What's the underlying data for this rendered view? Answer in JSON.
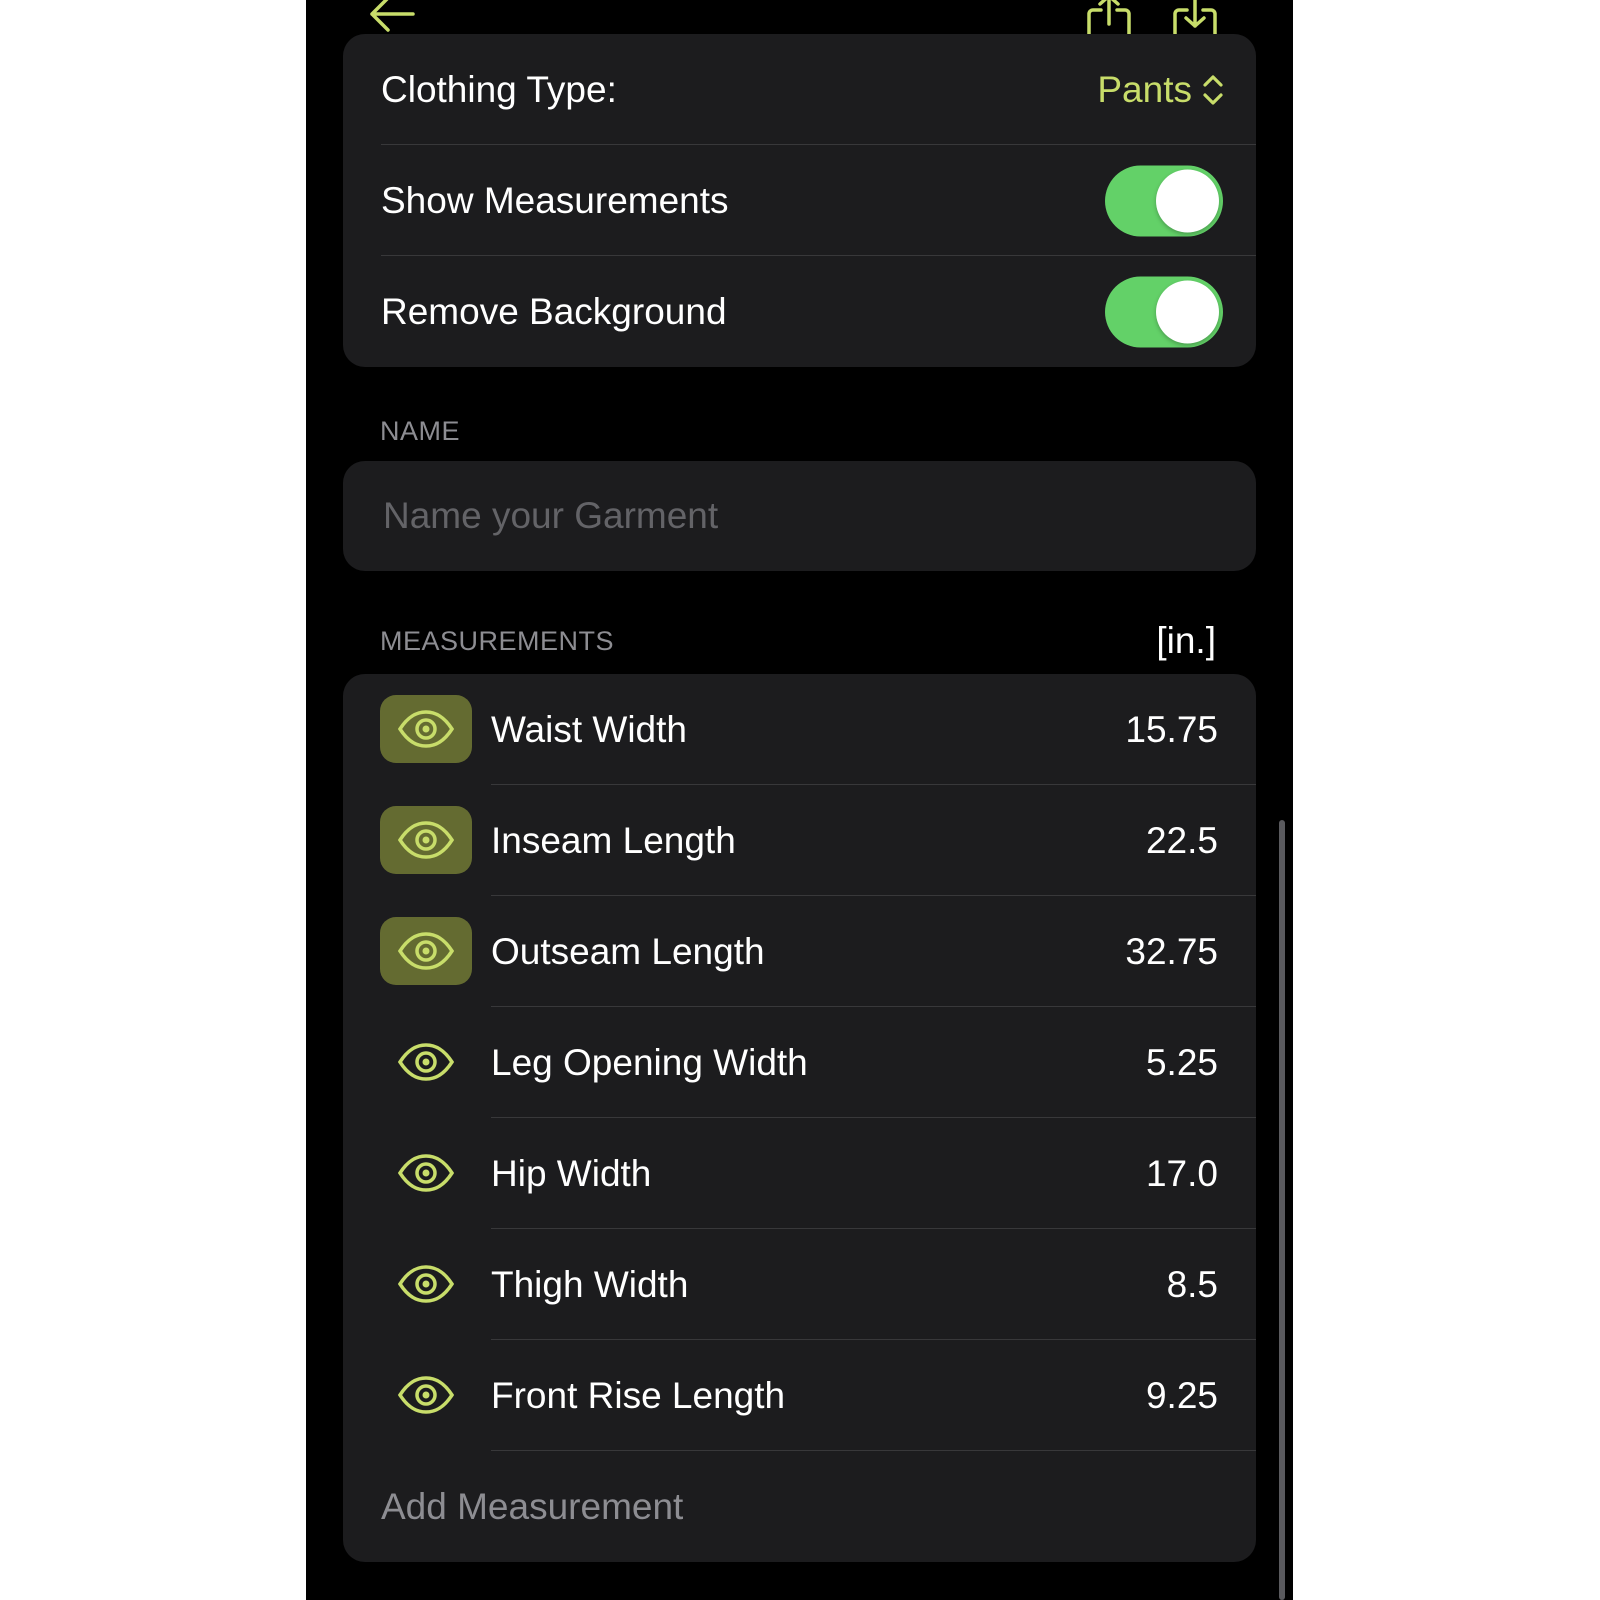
{
  "options": {
    "clothing_type_label": "Clothing Type:",
    "clothing_type_value": "Pants",
    "show_measurements_label": "Show Measurements",
    "show_measurements_on": true,
    "remove_background_label": "Remove Background",
    "remove_background_on": true
  },
  "name_section": {
    "header": "NAME",
    "placeholder": "Name your Garment",
    "value": ""
  },
  "measurements_section": {
    "header": "MEASUREMENTS",
    "unit": "[in.]",
    "items": [
      {
        "label": "Waist Width",
        "value": "15.75",
        "highlighted": true
      },
      {
        "label": "Inseam Length",
        "value": "22.5",
        "highlighted": true
      },
      {
        "label": "Outseam Length",
        "value": "32.75",
        "highlighted": true
      },
      {
        "label": "Leg Opening Width",
        "value": "5.25",
        "highlighted": false
      },
      {
        "label": "Hip Width",
        "value": "17.0",
        "highlighted": false
      },
      {
        "label": "Thigh Width",
        "value": "8.5",
        "highlighted": false
      },
      {
        "label": "Front Rise Length",
        "value": "9.25",
        "highlighted": false
      }
    ],
    "add_label": "Add Measurement"
  },
  "colors": {
    "accent": "#c8dd6a",
    "toggle_on": "#63d168",
    "eye_box_active": "#646b31",
    "card": "#1c1c1e"
  },
  "icons": {
    "back": "arrow-left-icon",
    "share": "share-icon",
    "download": "download-icon",
    "eye": "eye-icon",
    "picker": "chevron-up-down-icon"
  }
}
